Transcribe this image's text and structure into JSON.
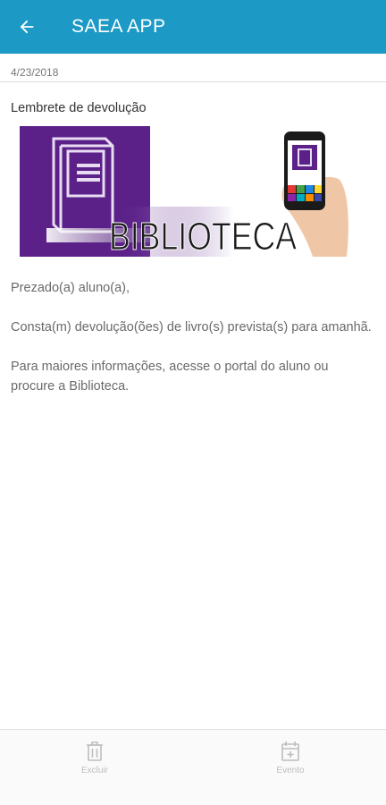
{
  "appbar": {
    "title": "SAEA APP",
    "back_icon": "arrow-left-icon"
  },
  "message": {
    "date": "4/23/2018",
    "subject": "Lembrete de devolução",
    "banner": {
      "word": "BIBLIOTECA",
      "color_purple": "#5b2189"
    },
    "paragraphs": [
      "Prezado(a) aluno(a),",
      "Consta(m) devolução(ões) de livro(s) prevista(s) para amanhã.",
      "Para maiores informações, acesse o portal do aluno ou procure a Biblioteca."
    ]
  },
  "bottom_bar": {
    "delete_label": "Excluir",
    "event_label": "Evento"
  },
  "colors": {
    "accent": "#1c9ac5"
  }
}
